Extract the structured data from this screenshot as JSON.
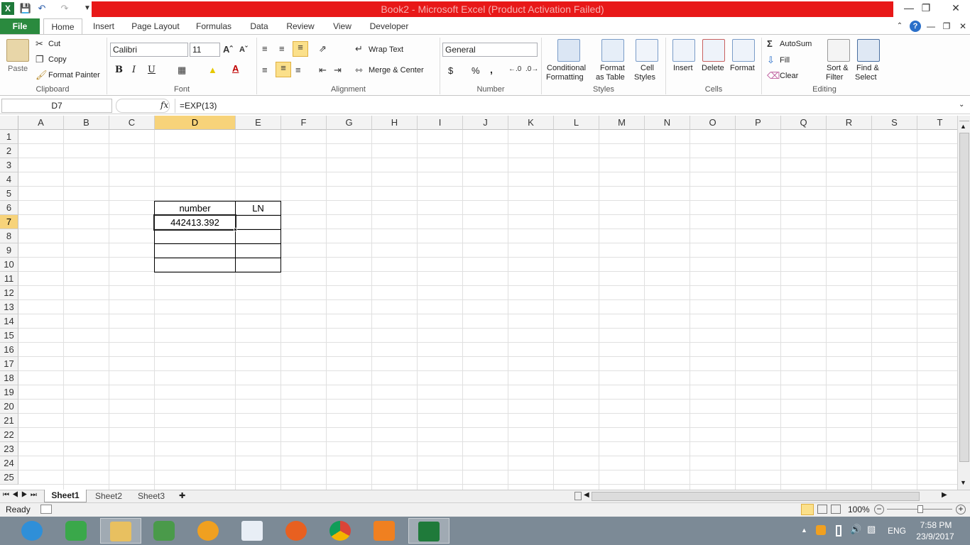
{
  "window": {
    "title": "Book2 -  Microsoft Excel (Product Activation Failed)",
    "controls": [
      "minimize-icon",
      "restore-icon",
      "close-icon"
    ]
  },
  "quick_access": [
    "save-icon",
    "undo-icon",
    "redo-icon",
    "customize-icon"
  ],
  "tabs": [
    "File",
    "Home",
    "Insert",
    "Page Layout",
    "Formulas",
    "Data",
    "Review",
    "View",
    "Developer"
  ],
  "ribbon": {
    "clipboard": {
      "label": "Clipboard",
      "paste": "Paste",
      "cut": "Cut",
      "copy": "Copy",
      "format_painter": "Format Painter"
    },
    "font": {
      "label": "Font",
      "name": "Calibri",
      "size": "11",
      "bold": "B",
      "italic": "I",
      "underline": "U"
    },
    "alignment": {
      "label": "Alignment",
      "wrap_text": "Wrap Text",
      "merge_center": "Merge & Center"
    },
    "number": {
      "label": "Number",
      "format": "General",
      "currency": "$",
      "percent": "%",
      "comma": ","
    },
    "styles": {
      "label": "Styles",
      "conditional": "Conditional",
      "conditional2": "Formatting",
      "format_table": "Format",
      "format_table2": "as Table",
      "cell_styles": "Cell",
      "cell_styles2": "Styles"
    },
    "cells": {
      "label": "Cells",
      "insert": "Insert",
      "delete": "Delete",
      "format": "Format"
    },
    "editing": {
      "label": "Editing",
      "autosum": "AutoSum",
      "fill": "Fill",
      "clear": "Clear",
      "sort": "Sort &",
      "sort2": "Filter",
      "find": "Find &",
      "find2": "Select"
    }
  },
  "formula_bar": {
    "name_box": "D7",
    "fx": "fx",
    "formula": "=EXP(13)"
  },
  "columns": [
    "A",
    "B",
    "C",
    "D",
    "E",
    "F",
    "G",
    "H",
    "I",
    "J",
    "K",
    "L",
    "M",
    "N",
    "O",
    "P",
    "Q",
    "R",
    "S",
    "T"
  ],
  "rows": [
    "1",
    "2",
    "3",
    "4",
    "5",
    "6",
    "7",
    "8",
    "9",
    "10",
    "11",
    "12",
    "13",
    "14",
    "15",
    "16",
    "17",
    "18",
    "19",
    "20",
    "21",
    "22",
    "23",
    "24",
    "25"
  ],
  "selected_cell": "D7",
  "cells": {
    "D6": "number",
    "E6": "LN",
    "D7": "442413.392"
  },
  "sheets": [
    "Sheet1",
    "Sheet2",
    "Sheet3"
  ],
  "active_sheet": "Sheet1",
  "status": {
    "mode": "Ready",
    "zoom": "100%"
  },
  "taskbar": {
    "apps": [
      "internet-explorer",
      "wps-writer",
      "file-explorer",
      "evernote",
      "speedtest",
      "app-store",
      "firefox",
      "chrome",
      "video-player",
      "excel"
    ],
    "language": "ENG",
    "time": "7:58 PM",
    "date": "23/9/2017"
  },
  "colors": {
    "title_red": "#e81818",
    "file_green": "#2a8a3e",
    "selected_header": "#f7d37a"
  }
}
